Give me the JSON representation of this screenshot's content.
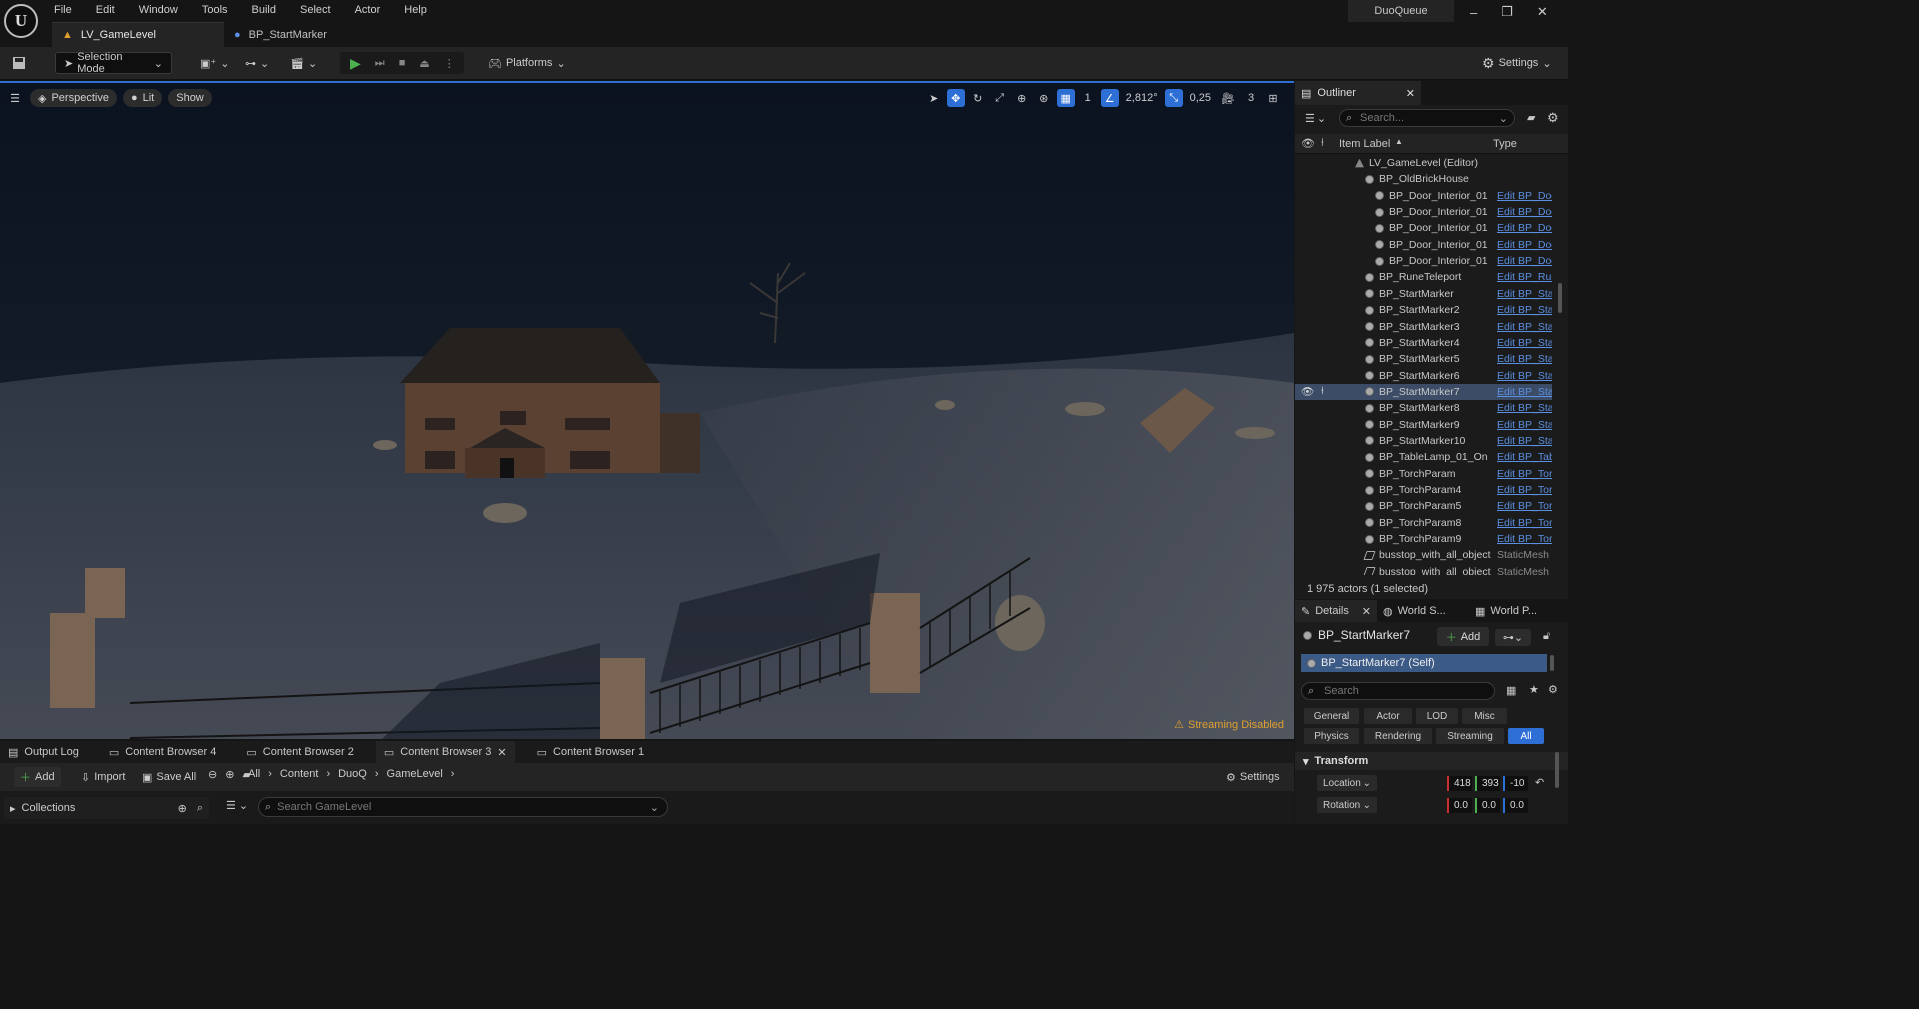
{
  "app": {
    "menu": [
      "File",
      "Edit",
      "Window",
      "Tools",
      "Build",
      "Select",
      "Actor",
      "Help"
    ],
    "project_name": "DuoQueue",
    "tabs": [
      {
        "label": "LV_GameLevel",
        "active": true
      },
      {
        "label": "BP_StartMarker",
        "active": false
      }
    ]
  },
  "toolbar": {
    "selection_mode": "Selection Mode",
    "platforms": "Platforms",
    "settings": "Settings"
  },
  "viewport": {
    "perspective": "Perspective",
    "lit": "Lit",
    "show": "Show",
    "grid_size": "1",
    "angle": "2,812°",
    "scale": "0,25",
    "camera_speed": "3",
    "streaming": "Streaming Disabled"
  },
  "bottom": {
    "tabs": [
      {
        "label": "Output Log",
        "active": false
      },
      {
        "label": "Content Browser 4",
        "active": false
      },
      {
        "label": "Content Browser 2",
        "active": false
      },
      {
        "label": "Content Browser 3",
        "active": true
      },
      {
        "label": "Content Browser 1",
        "active": false
      }
    ],
    "add": "Add",
    "import": "Import",
    "save_all": "Save All",
    "path": [
      "All",
      "Content",
      "DuoQ",
      "GameLevel"
    ],
    "settings": "Settings",
    "collections": "Collections",
    "search_placeholder": "Search GameLevel"
  },
  "outliner": {
    "title": "Outliner",
    "search_placeholder": "Search...",
    "col_label": "Item Label",
    "col_type": "Type",
    "footer": "1 975 actors (1 selected)",
    "rows": [
      {
        "label": "LV_GameLevel (Editor)",
        "type": "",
        "indent": 0,
        "icon": "level"
      },
      {
        "label": "BP_OldBrickHouse",
        "type": "",
        "indent": 1,
        "icon": "actor"
      },
      {
        "label": "BP_Door_Interior_01",
        "type": "Edit BP_Doo",
        "indent": 2,
        "icon": "actor"
      },
      {
        "label": "BP_Door_Interior_01",
        "type": "Edit BP_Doo",
        "indent": 2,
        "icon": "actor"
      },
      {
        "label": "BP_Door_Interior_01",
        "type": "Edit BP_Doo",
        "indent": 2,
        "icon": "actor"
      },
      {
        "label": "BP_Door_Interior_01",
        "type": "Edit BP_Doo",
        "indent": 2,
        "icon": "actor"
      },
      {
        "label": "BP_Door_Interior_01",
        "type": "Edit BP_Doo",
        "indent": 2,
        "icon": "actor"
      },
      {
        "label": "BP_RuneTeleport",
        "type": "Edit BP_Run",
        "indent": 1,
        "icon": "actor"
      },
      {
        "label": "BP_StartMarker",
        "type": "Edit BP_Sta",
        "indent": 1,
        "icon": "actor"
      },
      {
        "label": "BP_StartMarker2",
        "type": "Edit BP_Sta",
        "indent": 1,
        "icon": "actor"
      },
      {
        "label": "BP_StartMarker3",
        "type": "Edit BP_Sta",
        "indent": 1,
        "icon": "actor"
      },
      {
        "label": "BP_StartMarker4",
        "type": "Edit BP_Sta",
        "indent": 1,
        "icon": "actor"
      },
      {
        "label": "BP_StartMarker5",
        "type": "Edit BP_Sta",
        "indent": 1,
        "icon": "actor"
      },
      {
        "label": "BP_StartMarker6",
        "type": "Edit BP_Sta",
        "indent": 1,
        "icon": "actor"
      },
      {
        "label": "BP_StartMarker7",
        "type": "Edit BP_Sta",
        "indent": 1,
        "icon": "actor",
        "selected": true
      },
      {
        "label": "BP_StartMarker8",
        "type": "Edit BP_Sta",
        "indent": 1,
        "icon": "actor"
      },
      {
        "label": "BP_StartMarker9",
        "type": "Edit BP_Sta",
        "indent": 1,
        "icon": "actor"
      },
      {
        "label": "BP_StartMarker10",
        "type": "Edit BP_Sta",
        "indent": 1,
        "icon": "actor"
      },
      {
        "label": "BP_TableLamp_01_On",
        "type": "Edit BP_Tab",
        "indent": 1,
        "icon": "actor"
      },
      {
        "label": "BP_TorchParam",
        "type": "Edit BP_Tor",
        "indent": 1,
        "icon": "actor"
      },
      {
        "label": "BP_TorchParam4",
        "type": "Edit BP_Tor",
        "indent": 1,
        "icon": "actor"
      },
      {
        "label": "BP_TorchParam5",
        "type": "Edit BP_Tor",
        "indent": 1,
        "icon": "actor"
      },
      {
        "label": "BP_TorchParam8",
        "type": "Edit BP_Tor",
        "indent": 1,
        "icon": "actor"
      },
      {
        "label": "BP_TorchParam9",
        "type": "Edit BP_Tor",
        "indent": 1,
        "icon": "actor"
      },
      {
        "label": "busstop_with_all_object",
        "type": "StaticMesh",
        "indent": 1,
        "icon": "mesh"
      },
      {
        "label": "busstop_with_all_object",
        "type": "StaticMesh",
        "indent": 1,
        "icon": "mesh"
      }
    ]
  },
  "details": {
    "tabs": [
      {
        "label": "Details",
        "active": true
      },
      {
        "label": "World S...",
        "active": false
      },
      {
        "label": "World P...",
        "active": false
      }
    ],
    "actor_name": "BP_StartMarker7",
    "add": "Add",
    "self_row": "BP_StartMarker7 (Self)",
    "search_placeholder": "Search",
    "filters_row1": [
      "General",
      "Actor",
      "LOD",
      "Misc"
    ],
    "filters_row2": [
      "Physics",
      "Rendering",
      "Streaming",
      "All"
    ],
    "section": "Transform",
    "location_label": "Location",
    "rotation_label": "Rotation",
    "location": [
      "418",
      "393",
      "-10"
    ],
    "rotation": [
      "0.0",
      "0.0",
      "0.0"
    ]
  },
  "colors": {
    "accent": "#2e6fd6",
    "selected_row": "#3c4c66",
    "warning": "#e0a030",
    "play_green": "#4caf50"
  }
}
